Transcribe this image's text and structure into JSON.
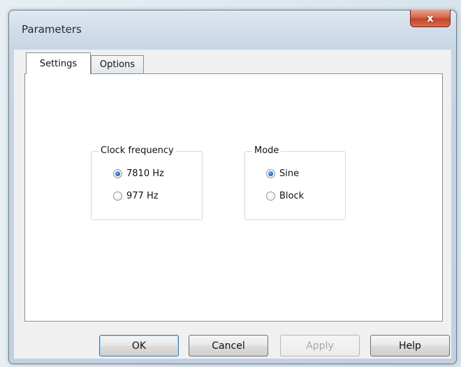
{
  "window": {
    "title": "Parameters",
    "close_label": "x"
  },
  "tabs": [
    {
      "label": "Settings",
      "selected": true
    },
    {
      "label": "Options",
      "selected": false
    }
  ],
  "settings": {
    "clock_frequency": {
      "title": "Clock frequency",
      "options": [
        {
          "label": "7810 Hz",
          "checked": true
        },
        {
          "label": "977 Hz",
          "checked": false
        }
      ]
    },
    "mode": {
      "title": "Mode",
      "options": [
        {
          "label": "Sine",
          "checked": true
        },
        {
          "label": "Block",
          "checked": false
        }
      ]
    }
  },
  "buttons": {
    "ok": "OK",
    "cancel": "Cancel",
    "apply": "Apply",
    "help": "Help"
  },
  "colors": {
    "radio_selected": "#1d5fb0",
    "close_button": "#c6452b"
  }
}
